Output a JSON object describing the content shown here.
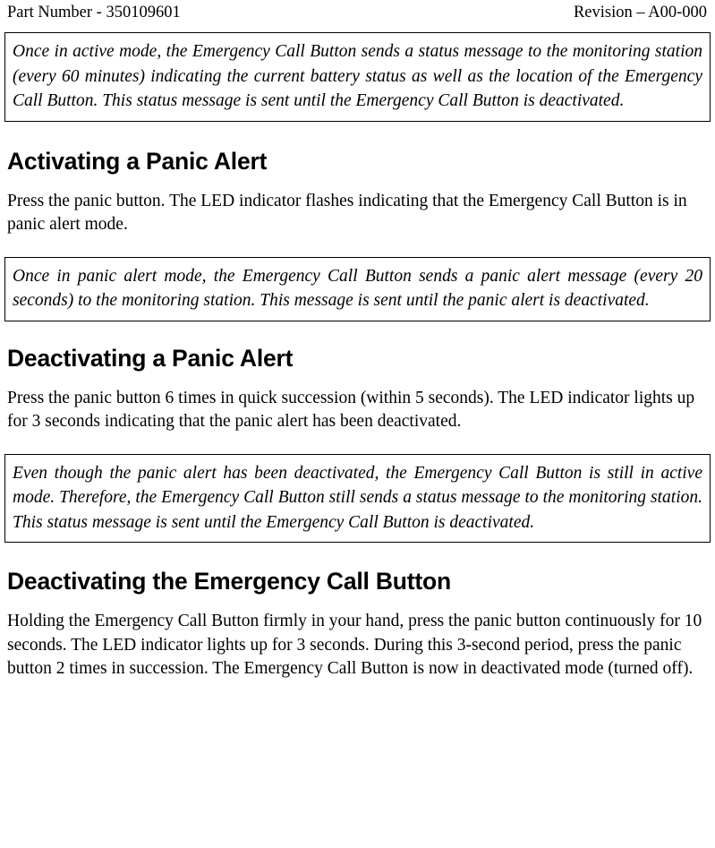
{
  "header": {
    "part_number": "Part Number - 350109601",
    "revision": "Revision – A00-000"
  },
  "notes": {
    "active_mode": "Once in active mode, the Emergency Call Button sends a status message to the monitoring station (every 60 minutes) indicating the current battery status as well as the location of the Emergency Call Button. This status message is sent until the Emergency Call Button is deactivated.",
    "panic_alert_mode": "Once in panic alert mode, the Emergency Call Button sends a panic alert message (every 20 seconds) to the monitoring station. This message is sent until the panic alert is deactivated.",
    "still_active_mode": "Even though the panic alert has been deactivated, the Emergency Call Button is still in active mode. Therefore, the Emergency Call Button still sends a status message to the monitoring station. This status message is sent until the Emergency Call Button is deactivated."
  },
  "sections": [
    {
      "heading": "Activating a Panic Alert",
      "body": "Press the panic button. The LED indicator flashes indicating that the Emergency Call Button is in panic alert mode."
    },
    {
      "heading": "Deactivating a Panic Alert",
      "body": "Press the panic button 6 times in quick succession (within 5 seconds). The LED indicator lights up for 3 seconds indicating that the panic alert has been deactivated."
    },
    {
      "heading": "Deactivating the Emergency Call Button",
      "body": "Holding the Emergency Call Button firmly in your hand, press the panic button continuously for 10 seconds. The LED indicator lights up for 3 seconds. During this 3-second period, press the panic button 2 times in succession. The Emergency Call Button is now in deactivated mode (turned off)."
    }
  ]
}
